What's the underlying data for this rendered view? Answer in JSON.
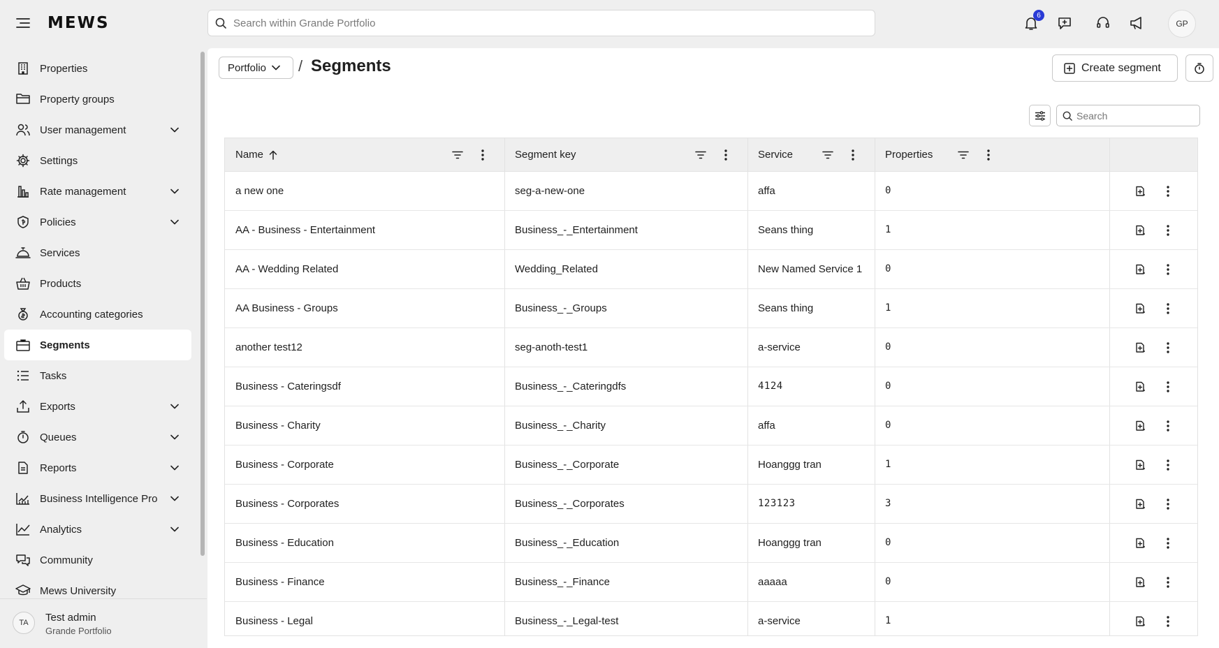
{
  "app": {
    "logo": "MEWS",
    "avatar_initials": "GP",
    "notifications_count": "6"
  },
  "search": {
    "placeholder": "Search within Grande Portfolio"
  },
  "sidebar": {
    "items": [
      {
        "label": "Properties",
        "icon": "building-icon",
        "expandable": false
      },
      {
        "label": "Property groups",
        "icon": "folder-icon",
        "expandable": false
      },
      {
        "label": "User management",
        "icon": "users-icon",
        "expandable": true
      },
      {
        "label": "Settings",
        "icon": "gear-icon",
        "expandable": false
      },
      {
        "label": "Rate management",
        "icon": "bar-chart-icon",
        "expandable": true
      },
      {
        "label": "Policies",
        "icon": "shield-icon",
        "expandable": true
      },
      {
        "label": "Services",
        "icon": "bell-icon",
        "expandable": false
      },
      {
        "label": "Products",
        "icon": "basket-icon",
        "expandable": false
      },
      {
        "label": "Accounting categories",
        "icon": "money-bag-icon",
        "expandable": false
      },
      {
        "label": "Segments",
        "icon": "briefcase-icon",
        "expandable": false,
        "active": true
      },
      {
        "label": "Tasks",
        "icon": "list-icon",
        "expandable": false
      },
      {
        "label": "Exports",
        "icon": "upload-icon",
        "expandable": true
      },
      {
        "label": "Queues",
        "icon": "timer-icon",
        "expandable": true
      },
      {
        "label": "Reports",
        "icon": "document-icon",
        "expandable": true
      },
      {
        "label": "Business Intelligence Pro",
        "icon": "trend-chart-icon",
        "expandable": true
      },
      {
        "label": "Analytics",
        "icon": "line-chart-icon",
        "expandable": true
      },
      {
        "label": "Community",
        "icon": "chat-icon",
        "expandable": false
      },
      {
        "label": "Mews University",
        "icon": "graduation-cap-icon",
        "expandable": false
      }
    ]
  },
  "user": {
    "initials": "TA",
    "name": "Test admin",
    "org": "Grande Portfolio"
  },
  "header": {
    "breadcrumb": "Portfolio",
    "separator": "/",
    "title": "Segments",
    "create_label": "Create segment"
  },
  "table_search": {
    "placeholder": "Search"
  },
  "table": {
    "columns": [
      {
        "label": "Name"
      },
      {
        "label": "Segment key"
      },
      {
        "label": "Service"
      },
      {
        "label": "Properties"
      }
    ],
    "sort": {
      "column": "Name",
      "direction": "ascending"
    },
    "rows": [
      {
        "name": "a new one",
        "key": "seg-a-new-one",
        "service": "affa",
        "properties": "0"
      },
      {
        "name": "AA - Business - Entertainment",
        "key": "Business_-_Entertainment",
        "service": "Seans thing",
        "properties": "1"
      },
      {
        "name": "AA - Wedding Related",
        "key": "Wedding_Related",
        "service": "New Named Service 1",
        "properties": "0"
      },
      {
        "name": "AA Business - Groups",
        "key": "Business_-_Groups",
        "service": "Seans thing",
        "properties": "1"
      },
      {
        "name": "another test12",
        "key": "seg-anoth-test1",
        "service": "a-service",
        "properties": "0"
      },
      {
        "name": "Business - Cateringsdf",
        "key": "Business_-_Cateringdfs",
        "service": "4124",
        "properties": "0"
      },
      {
        "name": "Business - Charity",
        "key": "Business_-_Charity",
        "service": "affa",
        "properties": "0"
      },
      {
        "name": "Business - Corporate",
        "key": "Business_-_Corporate",
        "service": "Hoanggg tran",
        "properties": "1"
      },
      {
        "name": "Business - Corporates",
        "key": "Business_-_Corporates",
        "service": "123123",
        "properties": "3"
      },
      {
        "name": "Business - Education",
        "key": "Business_-_Education",
        "service": "Hoanggg tran",
        "properties": "0"
      },
      {
        "name": "Business - Finance",
        "key": "Business_-_Finance",
        "service": "aaaaa",
        "properties": "0"
      },
      {
        "name": "Business - Legal",
        "key": "Business_-_Legal-test",
        "service": "a-service",
        "properties": "1"
      }
    ]
  },
  "colors": {
    "accent": "#2a3bd6",
    "background": "#efefef",
    "surface": "#ffffff",
    "border": "#e2e2e2"
  }
}
